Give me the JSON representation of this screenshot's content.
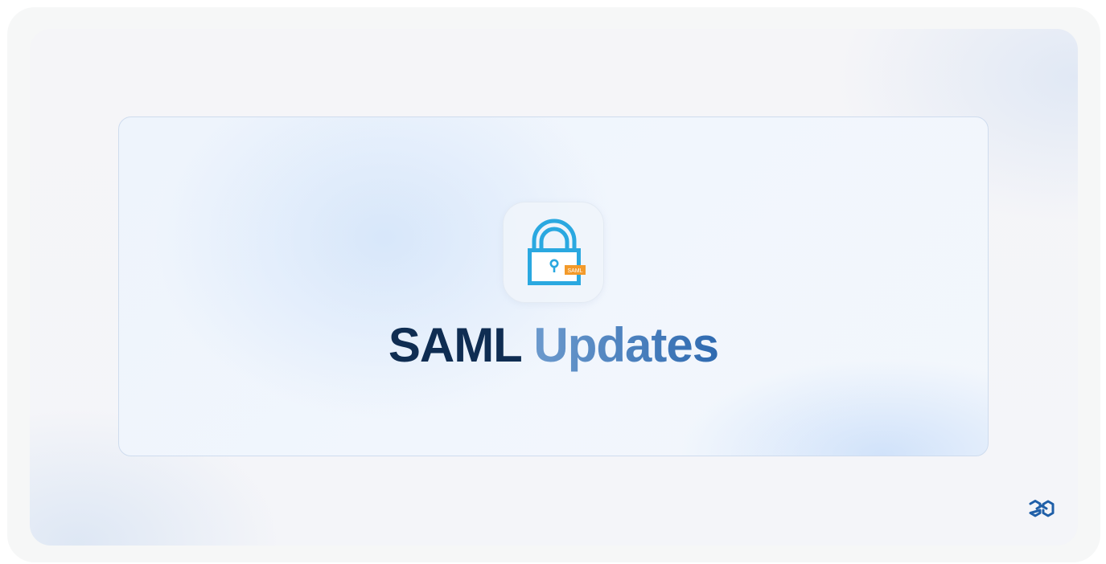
{
  "hero": {
    "title_primary": "SAML",
    "title_secondary": "Updates",
    "icon": "lock-icon",
    "icon_tag": "SAML"
  },
  "brand": {
    "logo": "brand-logo-icon"
  },
  "colors": {
    "title_primary": "#0f2d52",
    "title_secondary_start": "#6c9acd",
    "title_secondary_end": "#2f6ab0",
    "lock_blue": "#2aa8e0",
    "tag_orange": "#f39a2a",
    "logo_blue": "#1f5fa8",
    "card_border": "#cfdcee"
  }
}
